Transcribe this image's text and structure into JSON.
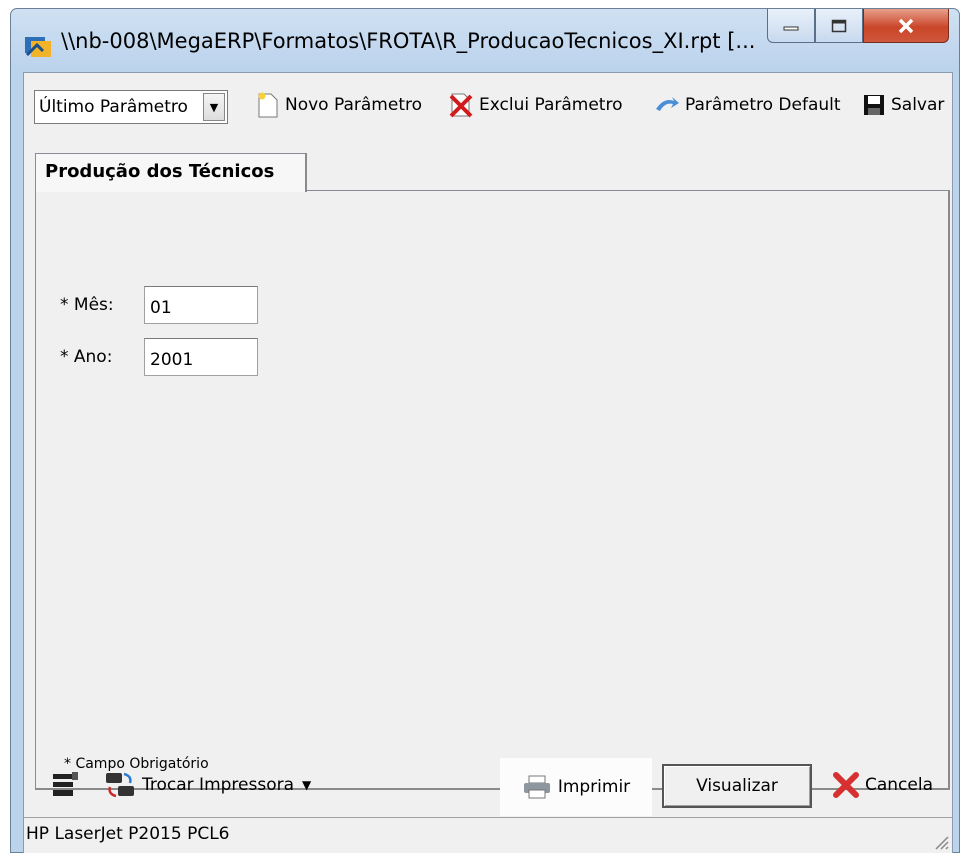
{
  "window": {
    "title": "\\\\nb-008\\MegaERP\\Formatos\\FROTA\\R_ProducaoTecnicos_XI.rpt [..."
  },
  "toolbar": {
    "param_select": "Último Parâmetro",
    "new_param": "Novo Parâmetro",
    "delete_param": "Exclui Parâmetro",
    "default_param": "Parâmetro Default",
    "save": "Salvar"
  },
  "tab": {
    "label": "Produção dos Técnicos"
  },
  "form": {
    "month_label": "* Mês:",
    "month_value": "01",
    "year_label": "* Ano:",
    "year_value": "2001",
    "required_note": "* Campo Obrigatório"
  },
  "bottom": {
    "change_printer": "Trocar Impressora",
    "print": "Imprimir",
    "view": "Visualizar",
    "cancel": "Cancela"
  },
  "status": {
    "printer": "HP LaserJet P2015 PCL6"
  },
  "colors": {
    "title_bar": "#bcd3ec",
    "close_button": "#c9462a",
    "panel": "#f0f0f0"
  },
  "icons": [
    "app-icon",
    "minimize-icon",
    "maximize-icon",
    "close-icon",
    "new-document-icon",
    "delete-icon",
    "default-arrow-icon",
    "save-disk-icon",
    "printer-config-icon",
    "swap-printer-icon",
    "printer-icon",
    "cancel-x-icon",
    "resize-grip-icon"
  ]
}
